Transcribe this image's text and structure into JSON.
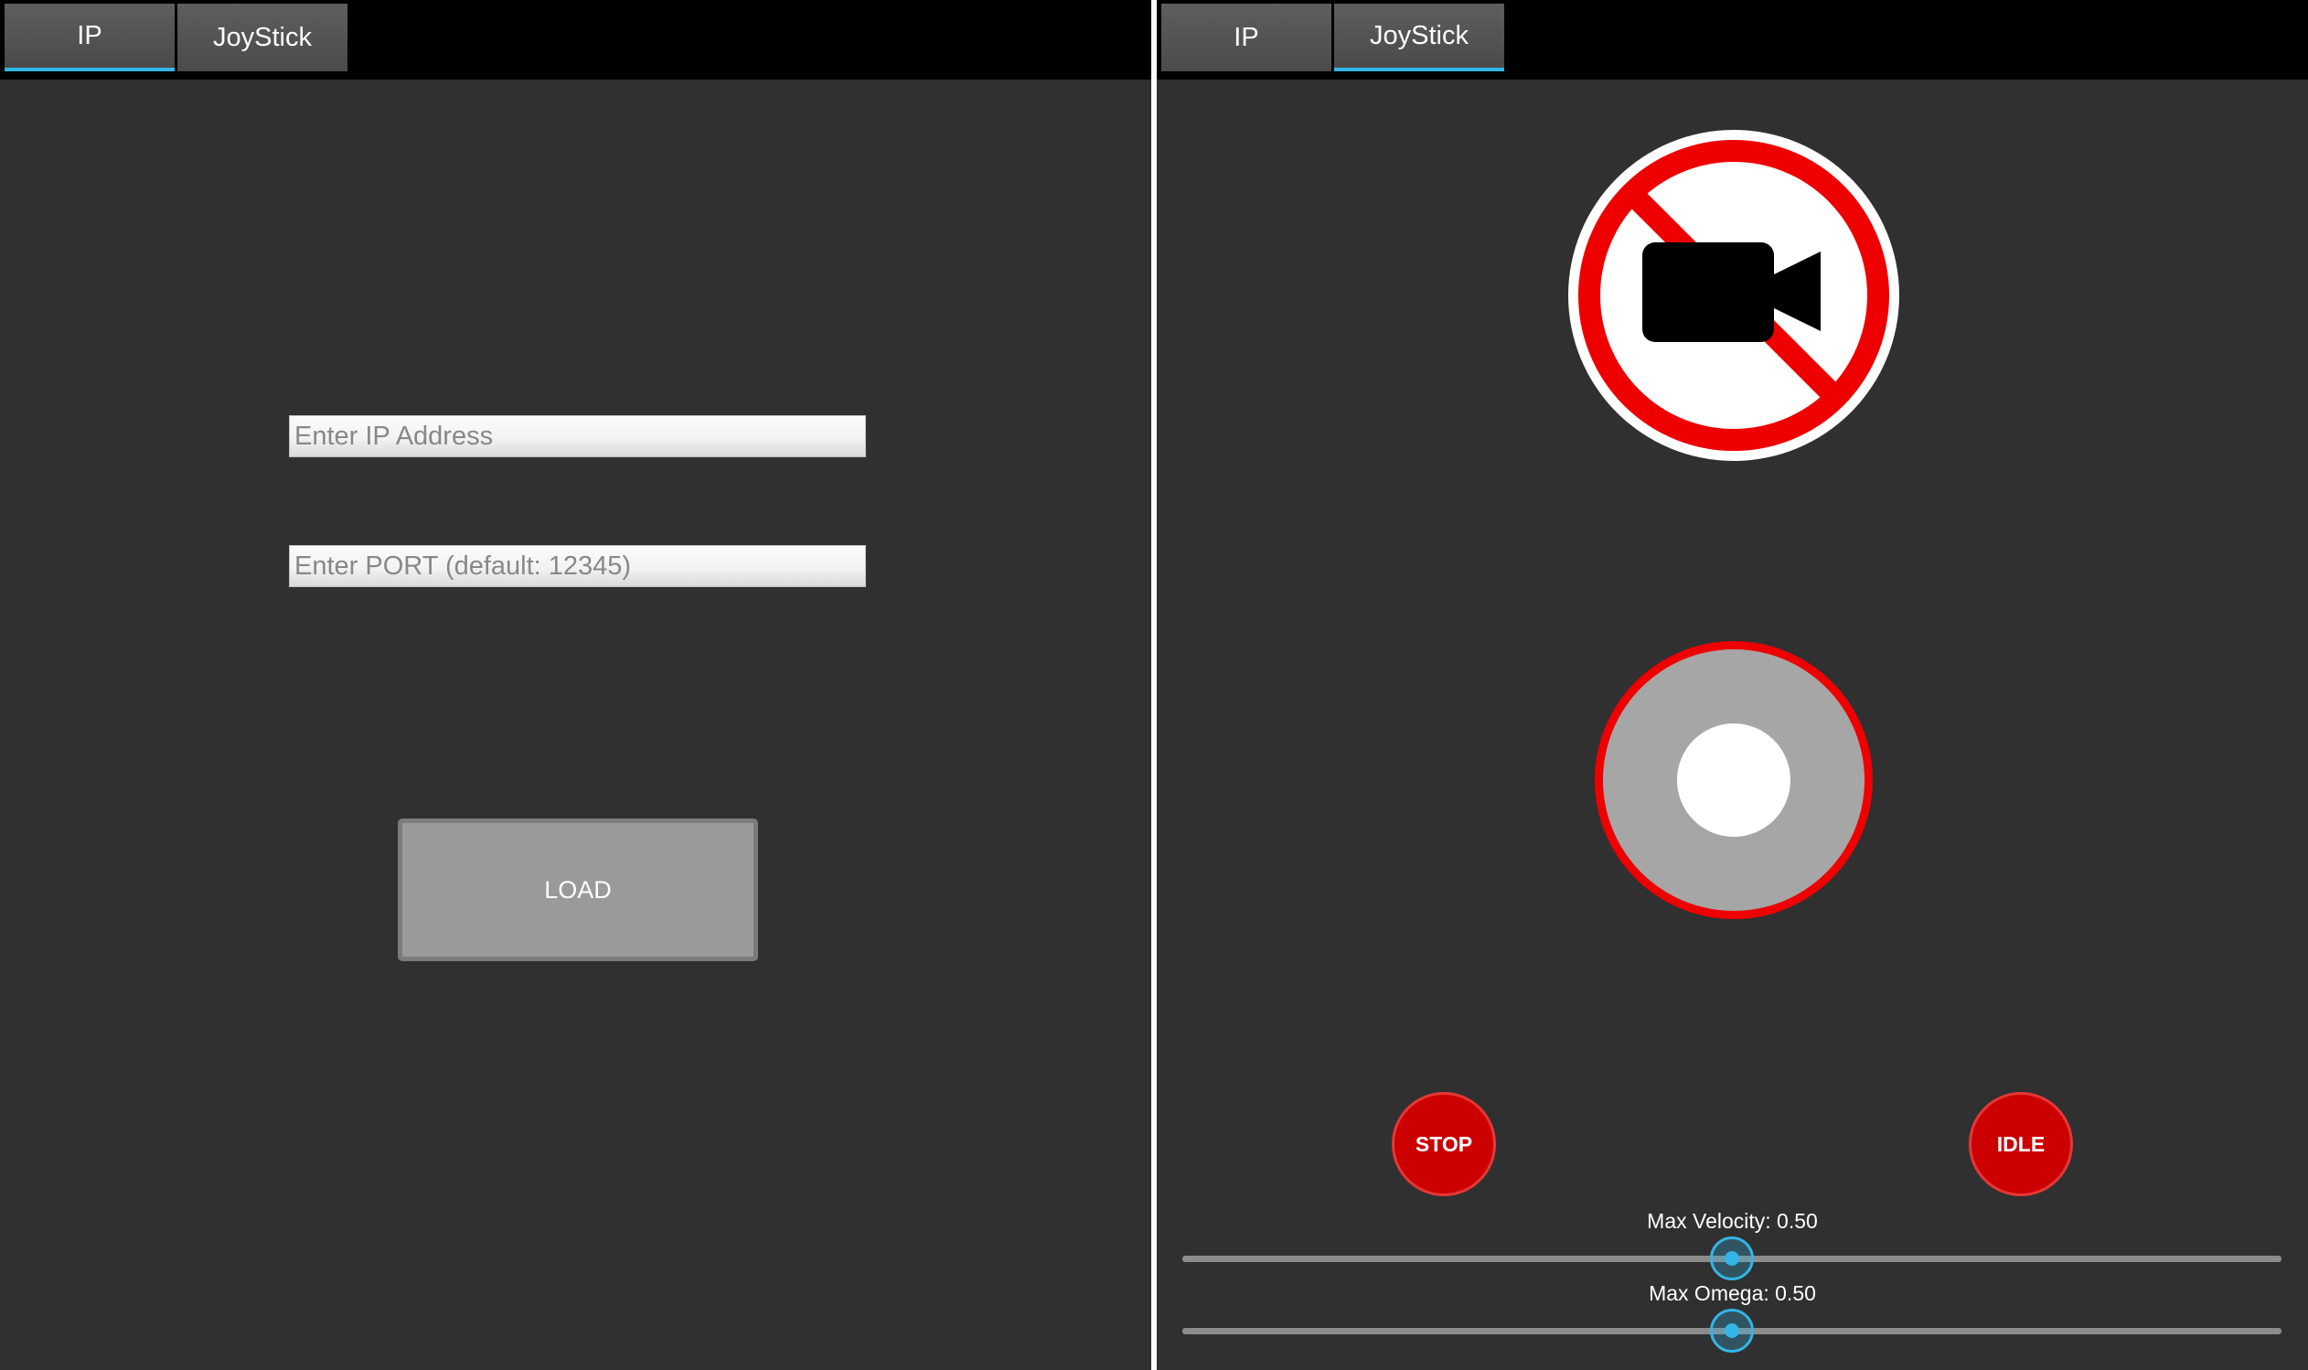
{
  "left_panel": {
    "tabs": [
      {
        "label": "IP",
        "active": true
      },
      {
        "label": "JoyStick",
        "active": false
      }
    ],
    "ip_input": {
      "value": "",
      "placeholder": "Enter IP Address"
    },
    "port_input": {
      "value": "",
      "placeholder": "Enter PORT (default: 12345)"
    },
    "load_label": "LOAD"
  },
  "right_panel": {
    "tabs": [
      {
        "label": "IP",
        "active": false
      },
      {
        "label": "JoyStick",
        "active": true
      }
    ],
    "camera_status_icon": "no-camera-icon",
    "stop_label": "STOP",
    "idle_label": "IDLE",
    "max_velocity": {
      "label": "Max Velocity: 0.50",
      "value": 0.5
    },
    "max_omega": {
      "label": "Max Omega: 0.50",
      "value": 0.5
    }
  },
  "colors": {
    "background": "#303030",
    "accent": "#33b5e5",
    "danger": "#cc0000",
    "joystick_ring": "#ee0000"
  }
}
